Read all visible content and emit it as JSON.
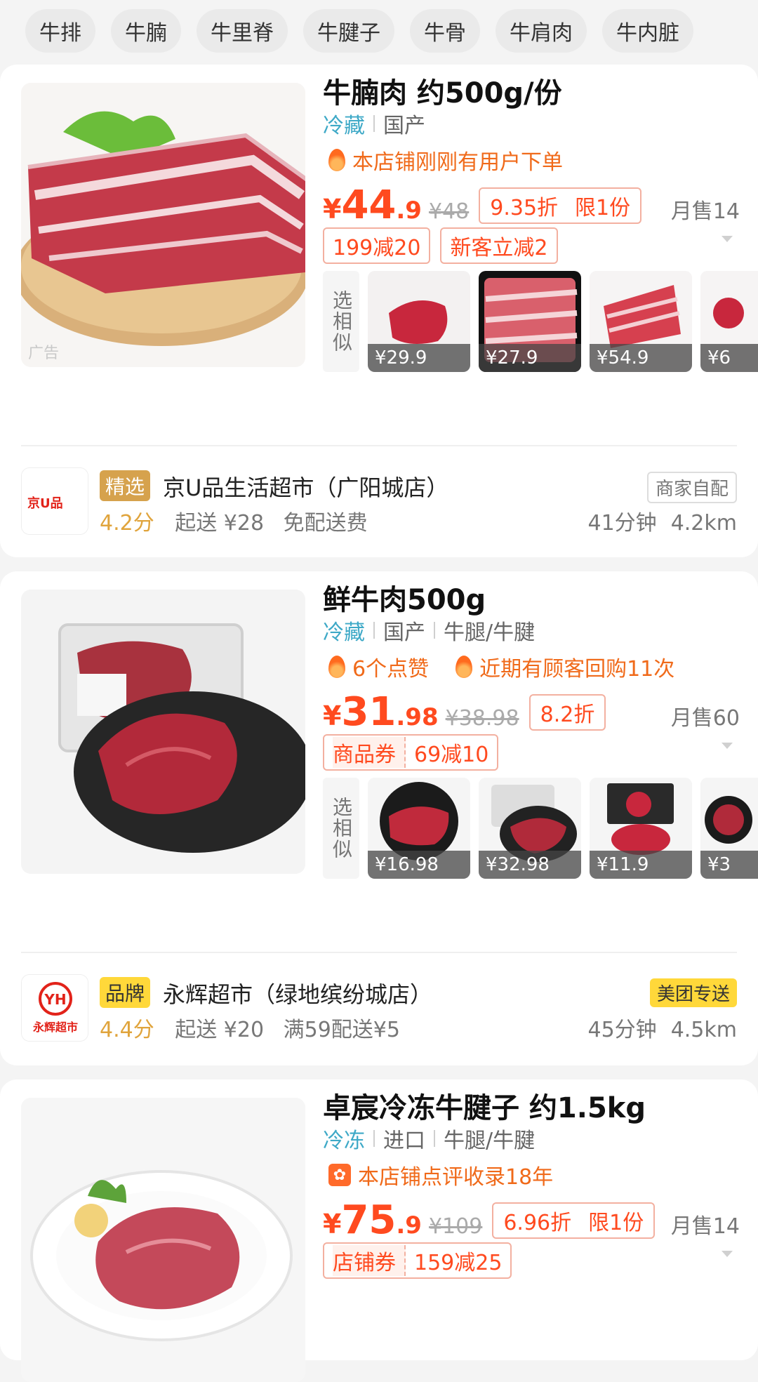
{
  "tabs": [
    "牛排",
    "牛腩",
    "牛里脊",
    "牛腱子",
    "牛骨",
    "牛肩肉",
    "牛内脏"
  ],
  "products": [
    {
      "title": "牛腩肉 约500g/份",
      "ad_label": "广告",
      "tags": [
        "冷藏",
        "国产"
      ],
      "hot": [
        "本店铺刚刚有用户下单"
      ],
      "price": {
        "currency": "¥",
        "int": "44",
        "dec": ".9",
        "old": "¥48",
        "discount": "9.35折",
        "limit": "限1份"
      },
      "monthly": "月售14",
      "coupons": [
        {
          "label": "",
          "value": "199减20"
        },
        {
          "label": "",
          "value": "新客立减2"
        }
      ],
      "similar_label": "选相似",
      "similar": [
        "¥29.9",
        "¥27.9",
        "¥54.9",
        "¥6"
      ],
      "store": {
        "badge": "精选",
        "name": "京U品生活超市（广阳城店）",
        "logo_text": "京U品",
        "score": "4.2分",
        "min": "起送 ¥28",
        "fee": "免配送费",
        "delivery": "商家自配",
        "time": "41分钟",
        "dist": "4.2km"
      }
    },
    {
      "title": "鲜牛肉500g",
      "tags": [
        "冷藏",
        "国产",
        "牛腿/牛腱"
      ],
      "hot": [
        "6个点赞",
        "近期有顾客回购11次"
      ],
      "price": {
        "currency": "¥",
        "int": "31",
        "dec": ".98",
        "old": "¥38.98",
        "discount": "8.2折",
        "limit": ""
      },
      "monthly": "月售60",
      "coupons": [
        {
          "label": "商品券",
          "value": "69减10"
        }
      ],
      "similar_label": "选相似",
      "similar": [
        "¥16.98",
        "¥32.98",
        "¥11.9",
        "¥3"
      ],
      "store": {
        "badge": "品牌",
        "name": "永辉超市（绿地缤纷城店）",
        "logo_text": "YH",
        "logo_sub": "永辉超市",
        "score": "4.4分",
        "min": "起送 ¥20",
        "fee": "满59配送¥5",
        "delivery": "美团专送",
        "time": "45分钟",
        "dist": "4.5km"
      }
    },
    {
      "title": "卓宸冷冻牛腱子 约1.5kg",
      "tags": [
        "冷冻",
        "进口",
        "牛腿/牛腱"
      ],
      "hot": [
        "本店铺点评收录18年"
      ],
      "price": {
        "currency": "¥",
        "int": "75",
        "dec": ".9",
        "old": "¥109",
        "discount": "6.96折",
        "limit": "限1份"
      },
      "monthly": "月售14",
      "coupons": [
        {
          "label": "店铺券",
          "value": "159减25"
        }
      ]
    }
  ],
  "colors": {
    "price": "#ff4a1f",
    "cold": "#3ea9c7",
    "score": "#e0a43c"
  }
}
